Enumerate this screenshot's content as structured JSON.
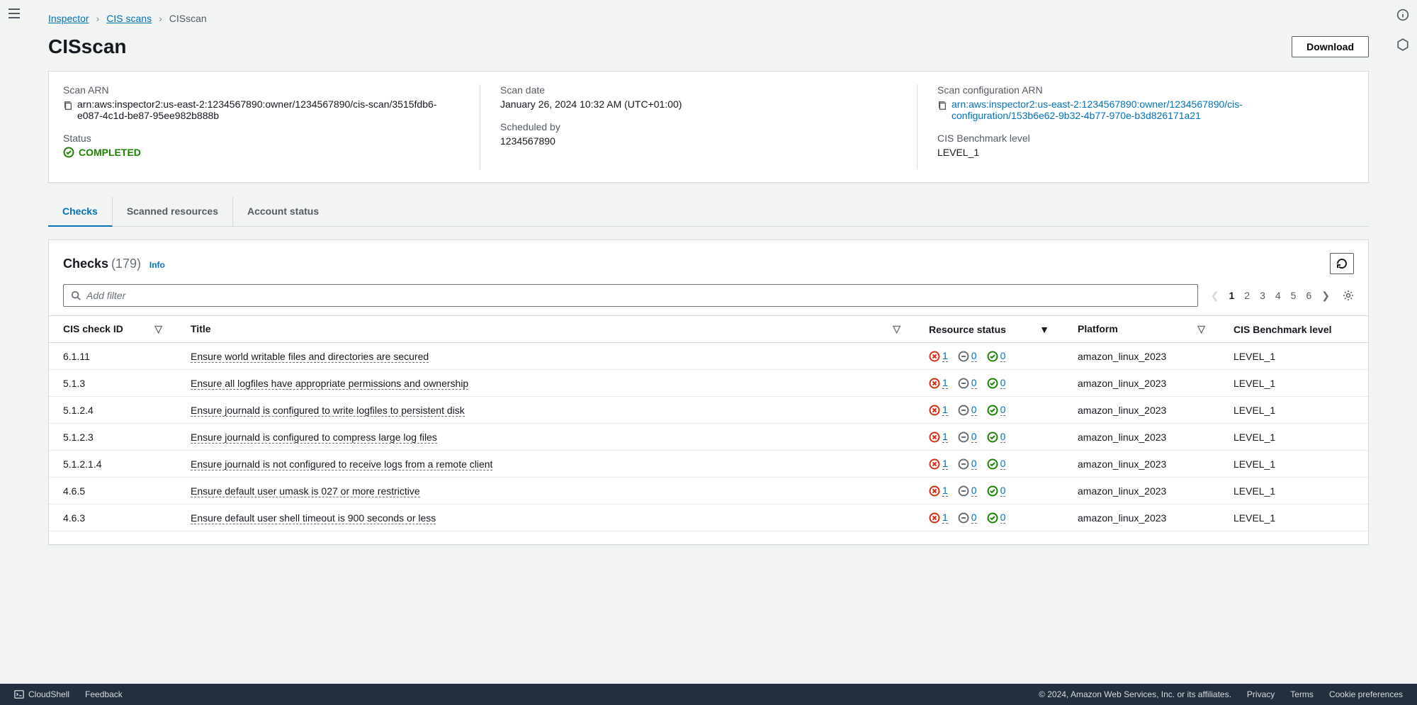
{
  "breadcrumb": {
    "items": [
      {
        "label": "Inspector",
        "link": true
      },
      {
        "label": "CIS scans",
        "link": true
      },
      {
        "label": "CISscan",
        "link": false
      }
    ]
  },
  "page": {
    "title": "CISscan",
    "download_label": "Download"
  },
  "summary": {
    "scan_arn_label": "Scan ARN",
    "scan_arn": "arn:aws:inspector2:us-east-2:1234567890:owner/1234567890/cis-scan/3515fdb6-e087-4c1d-be87-95ee982b888b",
    "status_label": "Status",
    "status_value": "COMPLETED",
    "scan_date_label": "Scan date",
    "scan_date": "January 26, 2024 10:32 AM (UTC+01:00)",
    "scheduled_by_label": "Scheduled by",
    "scheduled_by": "1234567890",
    "config_arn_label": "Scan configuration ARN",
    "config_arn": "arn:aws:inspector2:us-east-2:1234567890:owner/1234567890/cis-configuration/153b6e62-9b32-4b77-970e-b3d826171a21",
    "benchmark_label": "CIS Benchmark level",
    "benchmark_value": "LEVEL_1"
  },
  "tabs": {
    "items": [
      {
        "label": "Checks",
        "active": true
      },
      {
        "label": "Scanned resources",
        "active": false
      },
      {
        "label": "Account status",
        "active": false
      }
    ]
  },
  "checks": {
    "title": "Checks",
    "count": "(179)",
    "info_label": "Info",
    "filter_placeholder": "Add filter",
    "pages": [
      "1",
      "2",
      "3",
      "4",
      "5",
      "6"
    ],
    "columns": {
      "id": "CIS check ID",
      "title": "Title",
      "resource_status": "Resource status",
      "platform": "Platform",
      "benchmark": "CIS Benchmark level"
    },
    "rows": [
      {
        "id": "6.1.11",
        "title": "Ensure world writable files and directories are secured",
        "fail": "1",
        "na": "0",
        "pass": "0",
        "platform": "amazon_linux_2023",
        "level": "LEVEL_1"
      },
      {
        "id": "5.1.3",
        "title": "Ensure all logfiles have appropriate permissions and ownership",
        "fail": "1",
        "na": "0",
        "pass": "0",
        "platform": "amazon_linux_2023",
        "level": "LEVEL_1"
      },
      {
        "id": "5.1.2.4",
        "title": "Ensure journald is configured to write logfiles to persistent disk",
        "fail": "1",
        "na": "0",
        "pass": "0",
        "platform": "amazon_linux_2023",
        "level": "LEVEL_1"
      },
      {
        "id": "5.1.2.3",
        "title": "Ensure journald is configured to compress large log files",
        "fail": "1",
        "na": "0",
        "pass": "0",
        "platform": "amazon_linux_2023",
        "level": "LEVEL_1"
      },
      {
        "id": "5.1.2.1.4",
        "title": "Ensure journald is not configured to receive logs from a remote client",
        "fail": "1",
        "na": "0",
        "pass": "0",
        "platform": "amazon_linux_2023",
        "level": "LEVEL_1"
      },
      {
        "id": "4.6.5",
        "title": "Ensure default user umask is 027 or more restrictive",
        "fail": "1",
        "na": "0",
        "pass": "0",
        "platform": "amazon_linux_2023",
        "level": "LEVEL_1"
      },
      {
        "id": "4.6.3",
        "title": "Ensure default user shell timeout is 900 seconds or less",
        "fail": "1",
        "na": "0",
        "pass": "0",
        "platform": "amazon_linux_2023",
        "level": "LEVEL_1"
      }
    ]
  },
  "footer": {
    "cloudshell": "CloudShell",
    "feedback": "Feedback",
    "copyright": "© 2024, Amazon Web Services, Inc. or its affiliates.",
    "privacy": "Privacy",
    "terms": "Terms",
    "cookies": "Cookie preferences"
  }
}
